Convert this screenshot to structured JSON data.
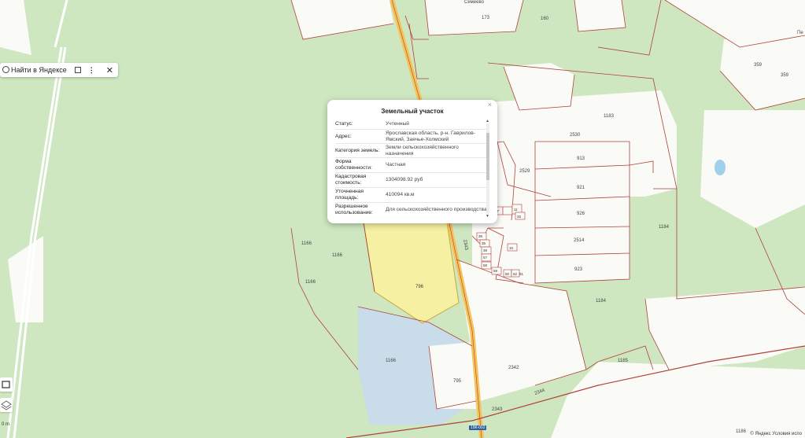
{
  "toolbar": {
    "find_label": "Найти в Яндексе",
    "more_label": "⋮",
    "close_label": "✕"
  },
  "popup": {
    "title": "Земельный участок",
    "close": "×",
    "rows": [
      {
        "label": "Статус:",
        "value": "Учтенный"
      },
      {
        "label": "Адрес:",
        "value": "Ярославская область, р-н. Гаврилов-Ямский, Заячье-Холмский"
      },
      {
        "label": "Категория земель:",
        "value": "Земли сельскохозяйственного назначения"
      },
      {
        "label": "Форма собственности:",
        "value": "Частная"
      },
      {
        "label": "Кадастровая стоимость:",
        "value": "1304098.92 руб"
      },
      {
        "label": "Уточненная площадь:",
        "value": "410094 кв.м"
      },
      {
        "label": "Разрешенное использование:",
        "value": "Для сельскохозяйственного производства"
      }
    ]
  },
  "parcel_labels": {
    "p173": "173",
    "p160": "160",
    "p359a": "359",
    "p359b": "359",
    "p1183": "1183",
    "p2530": "2530",
    "p913": "913",
    "p2529": "2529",
    "p921": "921",
    "p926": "926",
    "p2514": "2514",
    "p923": "923",
    "p1184a": "1184",
    "p1184b": "1184",
    "p1166a": "1166",
    "p1166b": "1166",
    "p1166c": "1166",
    "p1166d": "1166",
    "p796": "796",
    "p2343a": "2343",
    "p2342": "2342",
    "p795": "795",
    "p1185": "1185",
    "p2344": "2344",
    "p2343b": "2343",
    "p1186": "1186",
    "n17": "17",
    "n11": "11",
    "n25": "25",
    "n36": "36",
    "n35": "35",
    "n38": "38",
    "n57": "57",
    "n58": "58",
    "n10": "10",
    "n59": "59",
    "n60": "60",
    "n62": "62",
    "n61": "61",
    "top_village": "Семеево",
    "right_edge": "Пе"
  },
  "road_label": "19К-002",
  "scale_label": "0 m",
  "copyright": "© Яндекс  Условия испо",
  "colors": {
    "forest": "#cfe7c0",
    "field": "#fafaf7",
    "parcel_outline": "#b0413a",
    "selected_parcel": "#f6f0a2",
    "water": "#c8dcea",
    "road": "#f4c35a"
  }
}
